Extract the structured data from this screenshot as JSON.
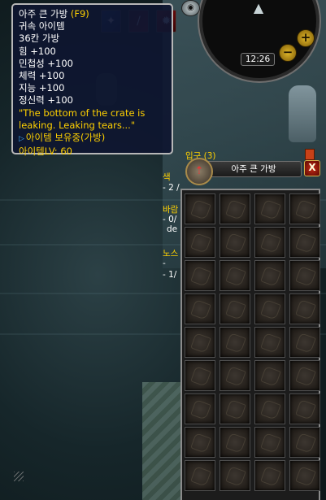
{
  "tooltip": {
    "item_name": "아주 큰 가방",
    "hotkey": "(F9)",
    "lines": [
      "귀속 아이템",
      "36칸 가방",
      "힘 +100",
      "민첩성 +100",
      "체력 +100",
      "지능 +100",
      "정신력 +100"
    ],
    "flavor": "\"The bottom of the crate is leaking. Leaking tears...\"",
    "requirement": "아이템 보유중(가방)",
    "item_level": "아이템LV: 60"
  },
  "minimap": {
    "clock": "12:26",
    "zoom_in": "+",
    "zoom_out": "−"
  },
  "quests": {
    "header": "입구 (3)",
    "q1_title": "색",
    "q1_obj": "- 2 /",
    "q2_title": "바람",
    "q2_obj_a": "- 0/",
    "q2_obj_b": "de",
    "q3_title": "노스",
    "q3_obj_a": "-",
    "q3_obj_b": "- 1/"
  },
  "bag": {
    "title": "아주 큰 가방",
    "close": "X",
    "slot_count": 36
  },
  "colors": {
    "tooltip_bg": "#0e1630",
    "quest_yellow": "#ffd100",
    "bag_frame": "#8b8b8b"
  }
}
